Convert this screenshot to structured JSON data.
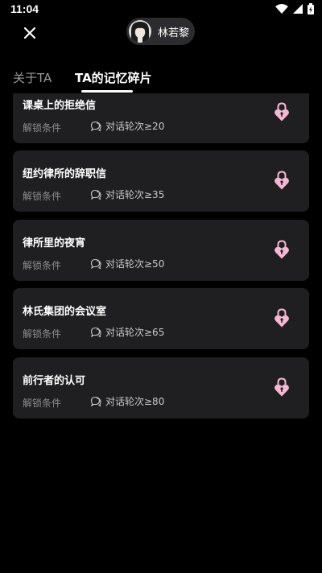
{
  "status_bar": {
    "time": "11:04"
  },
  "profile": {
    "name": "林若黎"
  },
  "tabs": [
    {
      "label": "关于TA"
    },
    {
      "label": "TA的记忆碎片",
      "active": true
    }
  ],
  "memories": [
    {
      "title": "课桌上的拒绝信",
      "unlock_label": "解锁条件",
      "condition": "对话轮次≥20"
    },
    {
      "title": "纽约律所的辞职信",
      "unlock_label": "解锁条件",
      "condition": "对话轮次≥35"
    },
    {
      "title": "律所里的夜宵",
      "unlock_label": "解锁条件",
      "condition": "对话轮次≥50"
    },
    {
      "title": "林氏集团的会议室",
      "unlock_label": "解锁条件",
      "condition": "对话轮次≥65"
    },
    {
      "title": "前行者的认可",
      "unlock_label": "解锁条件",
      "condition": "对话轮次≥80"
    }
  ],
  "colors": {
    "background": "#000000",
    "card": "#1f1f21",
    "lock": "#f4b7d4",
    "inactive_tab": "#9a9a9a"
  }
}
